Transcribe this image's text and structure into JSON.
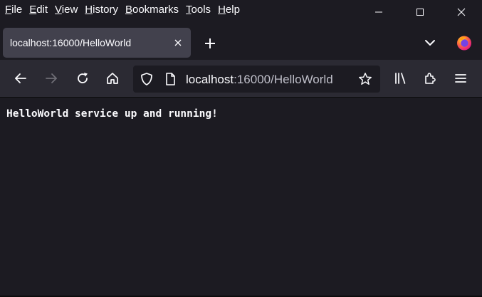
{
  "menu": {
    "items": [
      {
        "accel": "F",
        "rest": "ile"
      },
      {
        "accel": "E",
        "rest": "dit"
      },
      {
        "accel": "V",
        "rest": "iew"
      },
      {
        "accel": "H",
        "rest": "istory"
      },
      {
        "accel": "B",
        "rest": "ookmarks"
      },
      {
        "accel": "T",
        "rest": "ools"
      },
      {
        "accel": "H",
        "rest": "elp"
      }
    ]
  },
  "window_controls": {
    "icons": [
      "minimize-icon",
      "maximize-icon",
      "close-icon"
    ]
  },
  "tab": {
    "title": "localhost:16000/HelloWorld"
  },
  "urlbar": {
    "host": "localhost",
    "rest": ":16000/HelloWorld"
  },
  "page": {
    "message": "HelloWorld service up and running!"
  },
  "colors": {
    "background": "#1c1b22",
    "toolbar": "#2b2a33",
    "tab_selected": "#42414d",
    "text": "#fbfbfe",
    "text_dim": "#bfbfc9"
  }
}
